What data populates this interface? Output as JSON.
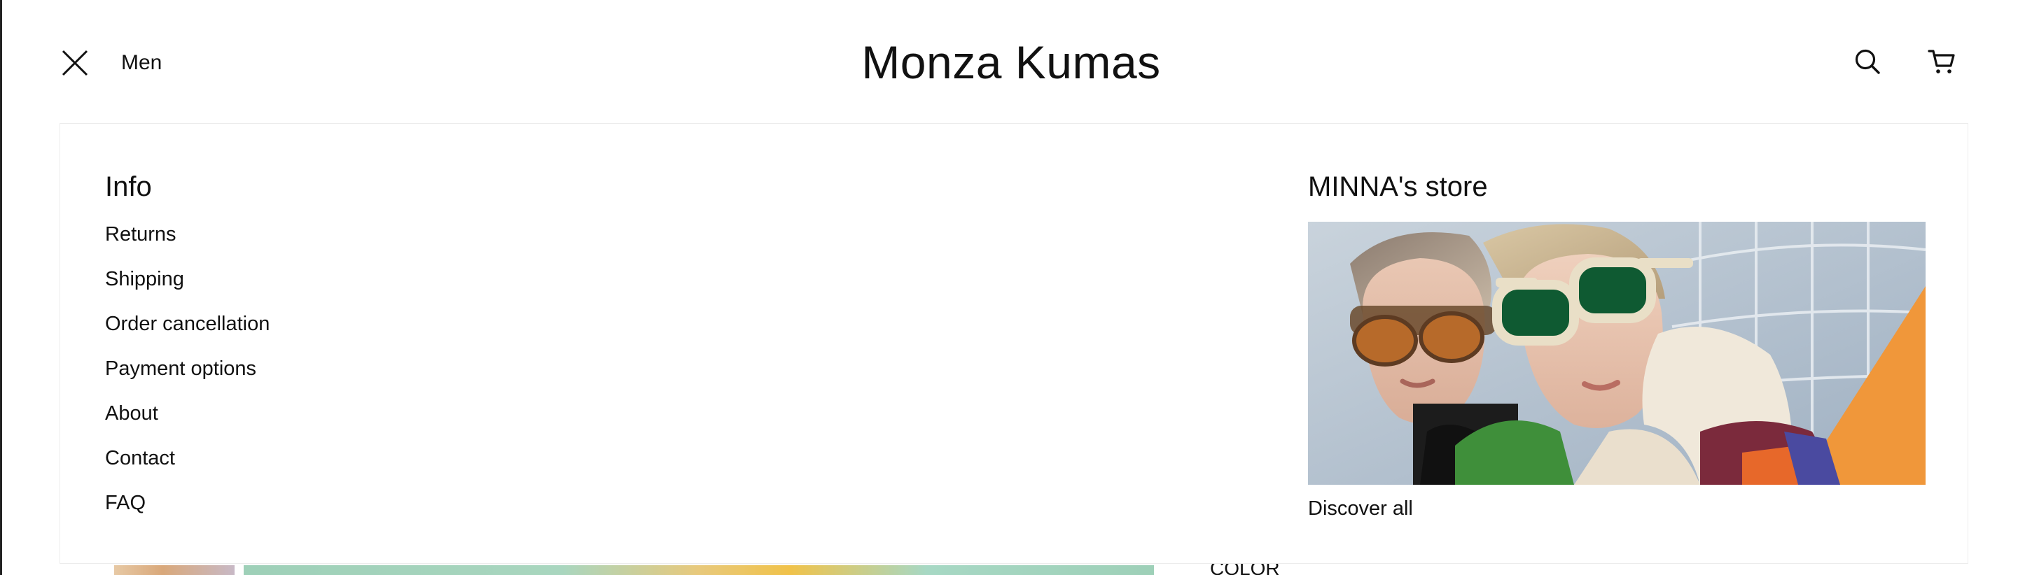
{
  "header": {
    "menu_label": "Men",
    "site_title": "Monza Kumas",
    "icons": {
      "close": "close-icon",
      "search": "search-icon",
      "cart": "cart-icon"
    }
  },
  "menu": {
    "info": {
      "heading": "Info",
      "items": [
        {
          "label": "Returns"
        },
        {
          "label": "Shipping"
        },
        {
          "label": "Order cancellation"
        },
        {
          "label": "Payment options"
        },
        {
          "label": "About"
        },
        {
          "label": "Contact"
        },
        {
          "label": "FAQ"
        }
      ]
    },
    "store": {
      "heading": "MINNA's store",
      "link_label": "Discover all"
    }
  },
  "background_page": {
    "color_label": "COLOR"
  },
  "colors": {
    "text": "#111111",
    "panel_border": "#ececec",
    "accent_orange": "#f0973a"
  }
}
